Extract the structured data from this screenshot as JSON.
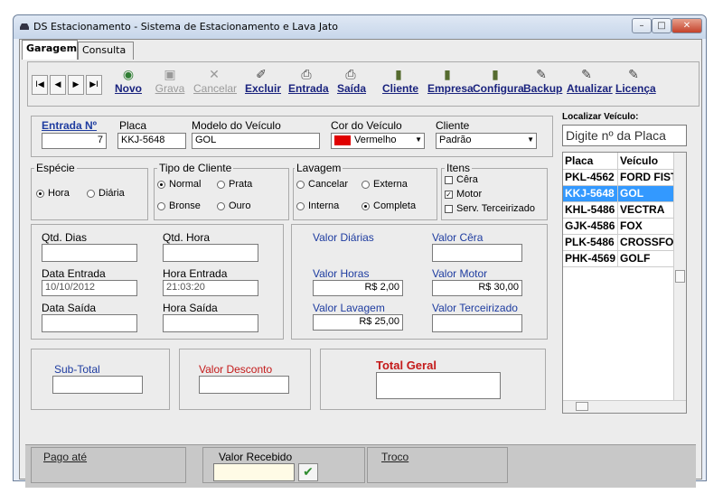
{
  "window": {
    "title": "DS Estacionamento - Sistema de Estacionamento e Lava Jato"
  },
  "tabs": [
    {
      "label": "Garagem"
    },
    {
      "label": "Consulta"
    }
  ],
  "nav": {
    "first": "I◀",
    "prev": "◀",
    "next": "▶",
    "last": "▶I"
  },
  "toolbar": [
    {
      "label": "Novo",
      "icon": "circle-icon"
    },
    {
      "label": "Grava",
      "icon": "save-icon"
    },
    {
      "label": "Cancelar",
      "icon": "cancel-icon"
    },
    {
      "label": "Excluir",
      "icon": "broom-icon"
    },
    {
      "label": "Entrada",
      "icon": "printer-icon"
    },
    {
      "label": "Saída",
      "icon": "printer-icon"
    },
    {
      "label": "Cliente",
      "icon": "book-icon"
    },
    {
      "label": "Empresa",
      "icon": "book-icon"
    },
    {
      "label": "Configura",
      "icon": "book-icon"
    },
    {
      "label": "Backup",
      "icon": "tool-icon"
    },
    {
      "label": "Atualizar",
      "icon": "tool-icon"
    },
    {
      "label": "Licença",
      "icon": "tool-icon"
    }
  ],
  "form": {
    "entrada_label": "Entrada Nº",
    "entrada_value": "7",
    "placa_label": "Placa",
    "placa_value": "KKJ-5648",
    "modelo_label": "Modelo do Veículo",
    "modelo_value": "GOL",
    "cor_label": "Cor do Veículo",
    "cor_value": "Vermelho",
    "cor_color": "#e00000",
    "cliente_label": "Cliente",
    "cliente_value": "Padrão",
    "especie": {
      "title": "Espécie",
      "hora": "Hora",
      "diaria": "Diária"
    },
    "tipo": {
      "title": "Tipo de Cliente",
      "normal": "Normal",
      "prata": "Prata",
      "bronse": "Bronse",
      "ouro": "Ouro"
    },
    "lavagem": {
      "title": "Lavagem",
      "cancelar": "Cancelar",
      "externa": "Externa",
      "interna": "Interna",
      "completa": "Completa"
    },
    "itens": {
      "title": "Itens",
      "cera": "Cêra",
      "motor": "Motor",
      "serv": "Serv. Terceirizado"
    },
    "qtd_dias": "Qtd. Dias",
    "qtd_hora": "Qtd. Hora",
    "data_entrada_label": "Data Entrada",
    "data_entrada_value": "10/10/2012",
    "hora_entrada_label": "Hora Entrada",
    "hora_entrada_value": "21:03:20",
    "data_saida_label": "Data Saída",
    "hora_saida_label": "Hora Saída",
    "valor_diarias": "Valor Diárias",
    "valor_cera": "Valor Cêra",
    "valor_horas_label": "Valor Horas",
    "valor_horas_value": "R$ 2,00",
    "valor_motor_label": "Valor Motor",
    "valor_motor_value": "R$ 30,00",
    "valor_lavagem_label": "Valor Lavagem",
    "valor_lavagem_value": "R$ 25,00",
    "valor_terceirizado": "Valor Terceirizado",
    "subtotal": "Sub-Total",
    "valor_desconto": "Valor Desconto",
    "total_geral": "Total Geral"
  },
  "side": {
    "title": "Localizar Veículo:",
    "search_placeholder": "Digite nº da Placa",
    "headers": [
      "Placa",
      "Veículo"
    ],
    "rows": [
      [
        "PKL-4562",
        "FORD FIST"
      ],
      [
        "KKJ-5648",
        "GOL"
      ],
      [
        "KHL-5486",
        "VECTRA"
      ],
      [
        "GJK-4586",
        "FOX"
      ],
      [
        "PLK-5486",
        "CROSSFOX"
      ],
      [
        "PHK-4569",
        "GOLF"
      ]
    ]
  },
  "footer": {
    "pago_ate": "Pago até",
    "valor_recebido": "Valor Recebido",
    "troco": "Troco"
  }
}
